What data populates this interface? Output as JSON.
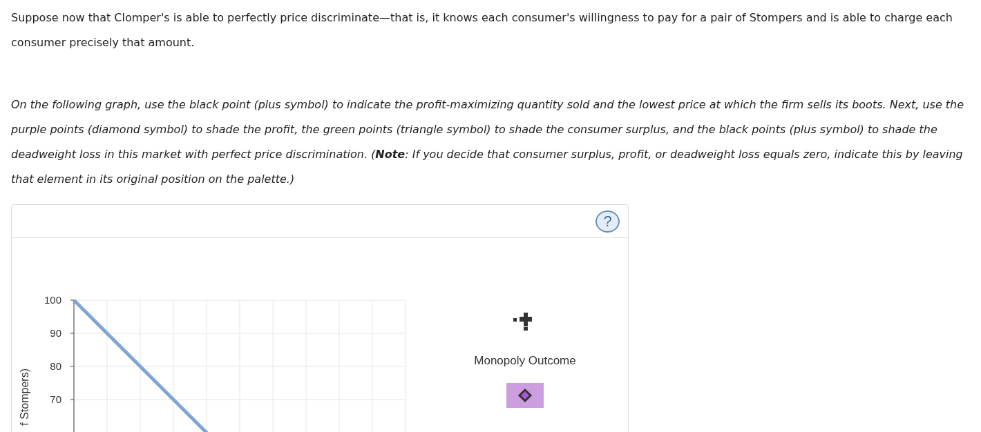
{
  "intro": "Suppose now that Clomper's is able to perfectly price discriminate—that is, it knows each consumer's willingness to pay for a pair of Stompers and is able to charge each consumer precisely that amount.",
  "instructions": "On the following graph, use the black point (plus symbol) to indicate the profit-maximizing quantity sold and the lowest price at which the firm sells its boots. Next, use the purple points (diamond symbol) to shade the profit, the green points (triangle symbol) to shade the consumer surplus, and the black points (plus symbol) to shade the deadweight loss in this market with perfect price discrimination. (**Note**: If you decide that consumer surplus, profit, or deadweight loss equals zero, indicate this by leaving that element in its original position on the palette.)",
  "help_button": "?",
  "graph": {
    "y_axis_label": "f Stompers)",
    "y_ticks": [
      "100",
      "90",
      "80",
      "70"
    ]
  },
  "palette": [
    {
      "kind": "plus",
      "label": "Monopoly Outcome"
    },
    {
      "kind": "diamond"
    }
  ]
}
